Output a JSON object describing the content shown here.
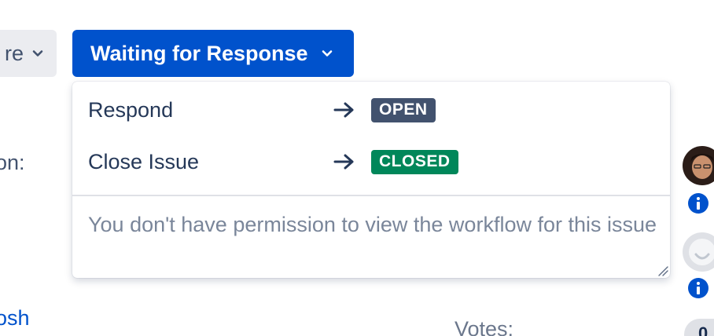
{
  "toolbar": {
    "more_label": "re",
    "status_label": "Waiting for Response"
  },
  "transitions": [
    {
      "label": "Respond",
      "target": "OPEN",
      "target_color": "#42526e"
    },
    {
      "label": "Close Issue",
      "target": "CLOSED",
      "target_color": "#00875a"
    }
  ],
  "permission_note": "You don't have permission to view the workflow for this issue",
  "background": {
    "field_label_fragment": "on:",
    "link_fragment": "osh",
    "votes_label": "Votes:",
    "votes_count": "0"
  },
  "colors": {
    "primary": "#0052cc",
    "open_lozenge": "#42526e",
    "closed_lozenge": "#00875a",
    "muted_text": "#7a869a"
  },
  "icons": [
    "chevron-down-icon",
    "arrow-right-icon",
    "info-icon",
    "avatar",
    "resize-grip-icon"
  ]
}
